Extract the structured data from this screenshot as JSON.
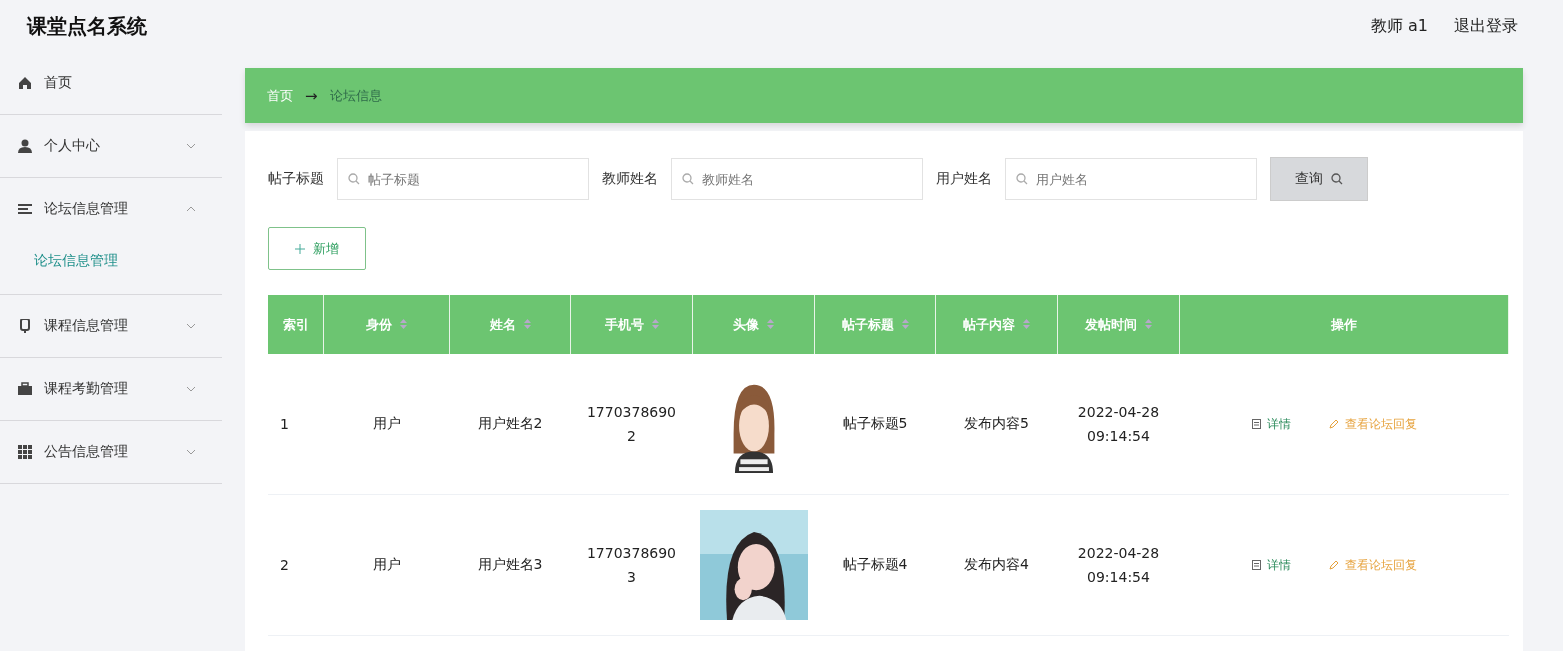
{
  "app_title": "课堂点名系统",
  "header": {
    "user": "教师 a1",
    "logout": "退出登录"
  },
  "sidebar": {
    "items": [
      {
        "label": "首页",
        "kind": "link"
      },
      {
        "label": "个人中心",
        "kind": "menu",
        "expanded": false
      },
      {
        "label": "论坛信息管理",
        "kind": "menu",
        "expanded": true,
        "children": [
          {
            "label": "论坛信息管理",
            "selected": true
          }
        ]
      },
      {
        "label": "课程信息管理",
        "kind": "menu",
        "expanded": false
      },
      {
        "label": "课程考勤管理",
        "kind": "menu",
        "expanded": false
      },
      {
        "label": "公告信息管理",
        "kind": "menu",
        "expanded": false
      }
    ]
  },
  "breadcrumb": {
    "home": "首页",
    "separator": "→",
    "current": "论坛信息"
  },
  "search": {
    "fields": [
      {
        "label": "帖子标题",
        "placeholder": "帖子标题"
      },
      {
        "label": "教师姓名",
        "placeholder": "教师姓名"
      },
      {
        "label": "用户姓名",
        "placeholder": "用户姓名"
      }
    ],
    "button": "查询"
  },
  "add_button": "新增",
  "table": {
    "columns": [
      {
        "label": "索引",
        "sortable": false
      },
      {
        "label": "身份",
        "sortable": true
      },
      {
        "label": "姓名",
        "sortable": true
      },
      {
        "label": "手机号",
        "sortable": true
      },
      {
        "label": "头像",
        "sortable": true
      },
      {
        "label": "帖子标题",
        "sortable": true
      },
      {
        "label": "帖子内容",
        "sortable": true
      },
      {
        "label": "发帖时间",
        "sortable": true
      },
      {
        "label": "操作",
        "sortable": false
      }
    ],
    "rows": [
      {
        "index": "1",
        "role": "用户",
        "name": "用户姓名2",
        "phone": "17703786902",
        "avatar": {
          "kind": "picture"
        },
        "title": "帖子标题5",
        "content": "发布内容5",
        "time": "2022-04-28 09:14:54",
        "actions": [
          "详情",
          "查看论坛回复"
        ]
      },
      {
        "index": "2",
        "role": "用户",
        "name": "用户姓名3",
        "phone": "17703786903",
        "avatar": {
          "kind": "picture"
        },
        "title": "帖子标题4",
        "content": "发布内容4",
        "time": "2022-04-28 09:14:54",
        "actions": [
          "详情",
          "查看论坛回复"
        ]
      }
    ]
  }
}
